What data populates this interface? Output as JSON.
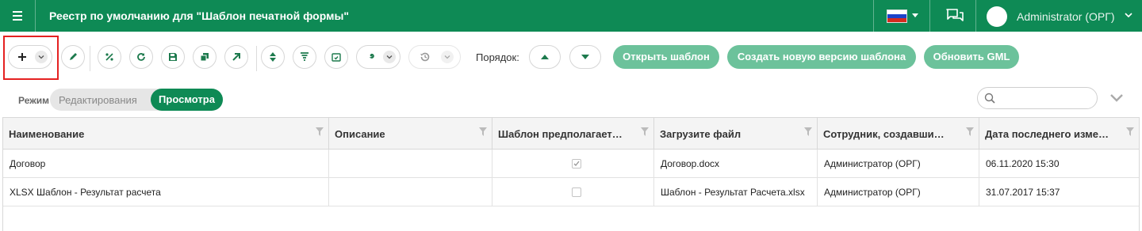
{
  "header": {
    "title": "Реестр по умолчанию для \"Шаблон печатной формы\"",
    "user": "Administrator (ОРГ)",
    "color": "#0e8a55"
  },
  "toolbar": {
    "order_label": "Порядок:",
    "open_template": "Открыть шаблон",
    "new_version": "Создать новую версию шаблона",
    "update_gml": "Обновить GML",
    "icons": [
      "plus-icon",
      "chevron-down-icon",
      "pencil-icon",
      "percent-icon",
      "refresh-icon",
      "save-icon",
      "copy-icon",
      "arrow-up-right-icon",
      "sort-icon",
      "filter-icon",
      "calendar-refresh-icon",
      "wrench-icon",
      "history-icon",
      "arrow-up-icon",
      "arrow-down-icon"
    ]
  },
  "mode": {
    "label": "Режим",
    "edit": "Редактирования",
    "view": "Просмотра",
    "active": "view"
  },
  "search": {
    "placeholder": ""
  },
  "table": {
    "columns": [
      "Наименование",
      "Описание",
      "Шаблон предполагает…",
      "Загрузите файл",
      "Сотрудник, создавши…",
      "Дата последнего изме…"
    ],
    "rows": [
      {
        "name": "Договор",
        "description": "",
        "checked": true,
        "file": "Договор.docx",
        "employee": "Администратор (ОРГ)",
        "date": "06.11.2020 15:30"
      },
      {
        "name": "XLSX Шаблон - Результат расчета",
        "description": "",
        "checked": false,
        "file": "Шаблон - Результат Расчета.xlsx",
        "employee": "Администратор (ОРГ)",
        "date": "31.07.2017 15:37"
      }
    ]
  }
}
